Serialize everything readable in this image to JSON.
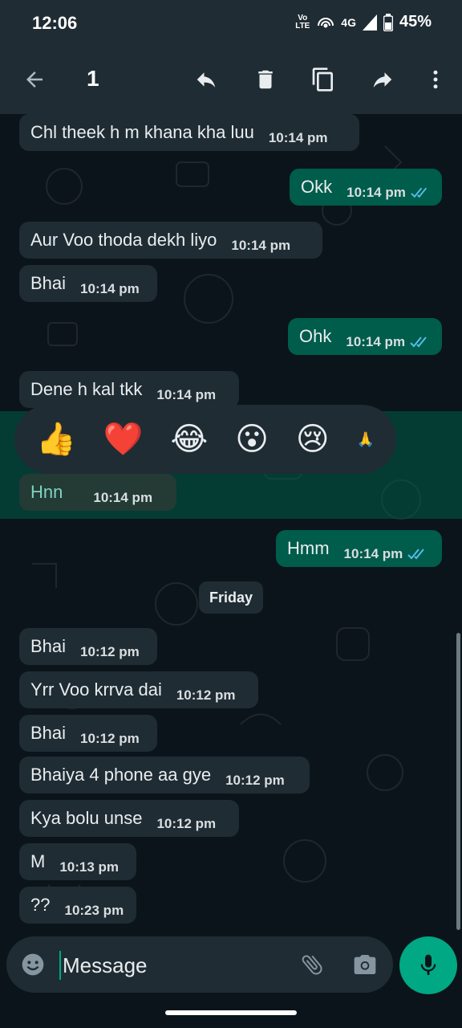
{
  "status_bar": {
    "time": "12:06",
    "volte_top": "Vo",
    "volte_bottom": "LTE",
    "network": "4G",
    "battery": "45%"
  },
  "toolbar": {
    "selected_count": "1",
    "icons": [
      "back-arrow-icon",
      "reply-icon",
      "delete-icon",
      "copy-icon",
      "forward-icon",
      "more-vertical-icon"
    ]
  },
  "colors": {
    "chat_bg": "#0b141a",
    "bar_bg": "#1f2c34",
    "incoming": "#1f2c34",
    "outgoing": "#005c4b",
    "accent": "#00a884",
    "read_ticks": "#53bdeb"
  },
  "messages": [
    {
      "dir": "in",
      "text": "Chl theek h m khana kha luu",
      "time": "10:14 pm"
    },
    {
      "dir": "out",
      "text": "Okk",
      "time": "10:14 pm"
    },
    {
      "dir": "in",
      "text": "Aur Voo thoda dekh liyo",
      "time": "10:14 pm"
    },
    {
      "dir": "in",
      "text": "Bhai",
      "time": "10:14 pm"
    },
    {
      "dir": "out",
      "text": "Ohk",
      "time": "10:14 pm"
    },
    {
      "dir": "in",
      "text": "Dene h kal tkk",
      "time": "10:14 pm"
    },
    {
      "dir": "in",
      "text": "Hnn",
      "time": "10:14 pm",
      "selected": true
    },
    {
      "dir": "out",
      "text": "Hmm",
      "time": "10:14 pm"
    },
    {
      "dir": "in",
      "text": "Bhai",
      "time": "10:12 pm"
    },
    {
      "dir": "in",
      "text": "Yrr Voo krrva dai",
      "time": "10:12 pm"
    },
    {
      "dir": "in",
      "text": "Bhai",
      "time": "10:12 pm"
    },
    {
      "dir": "in",
      "text": "Bhaiya 4 phone aa gye",
      "time": "10:12 pm"
    },
    {
      "dir": "in",
      "text": "Kya bolu unse",
      "time": "10:12 pm"
    },
    {
      "dir": "in",
      "text": "M",
      "time": "10:13 pm"
    },
    {
      "dir": "in",
      "text": "??",
      "time": "10:23 pm"
    }
  ],
  "day_separator": "Friday",
  "reactions": [
    "👍",
    "❤️",
    "😂",
    "😮",
    "😢",
    "🙏"
  ],
  "composer": {
    "placeholder": "Message",
    "icons": [
      "emoji-icon",
      "attach-icon",
      "camera-icon",
      "mic-icon"
    ]
  }
}
